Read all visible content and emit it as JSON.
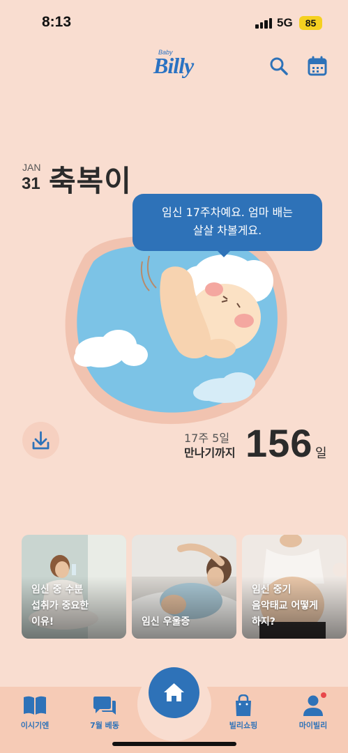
{
  "status_bar": {
    "time": "8:13",
    "network": "5G",
    "battery": "85"
  },
  "header": {
    "logo_small": "Baby",
    "logo": "Billy"
  },
  "profile": {
    "month": "JAN",
    "day": "31",
    "name": "축복이"
  },
  "bubble": {
    "text": "임신 17주차예요. 엄마 배는\n살살 차볼게요."
  },
  "countdown": {
    "week_day": "17주 5일",
    "label": "만나기까지",
    "days": "156",
    "unit": "일"
  },
  "cards": [
    {
      "title": "임신 중 수분\n섭취가 중요한\n이유!"
    },
    {
      "title": "임신 우울증"
    },
    {
      "title": "임신 중기\n음악태교 어떻게\n하지?"
    }
  ],
  "nav": [
    {
      "label": "이시기엔",
      "icon": "book-icon"
    },
    {
      "label": "7월 베동",
      "icon": "chat-icon"
    },
    {
      "label": "home",
      "icon": "home-icon"
    },
    {
      "label": "빌리쇼핑",
      "icon": "shopping-bag-icon"
    },
    {
      "label": "마이빌리",
      "icon": "person-icon"
    }
  ],
  "colors": {
    "background": "#f9ddd0",
    "primary": "#2e72b8",
    "nav_bg": "#f6cbb6",
    "sky": "#7cc3e6",
    "notification": "#e8484b"
  }
}
